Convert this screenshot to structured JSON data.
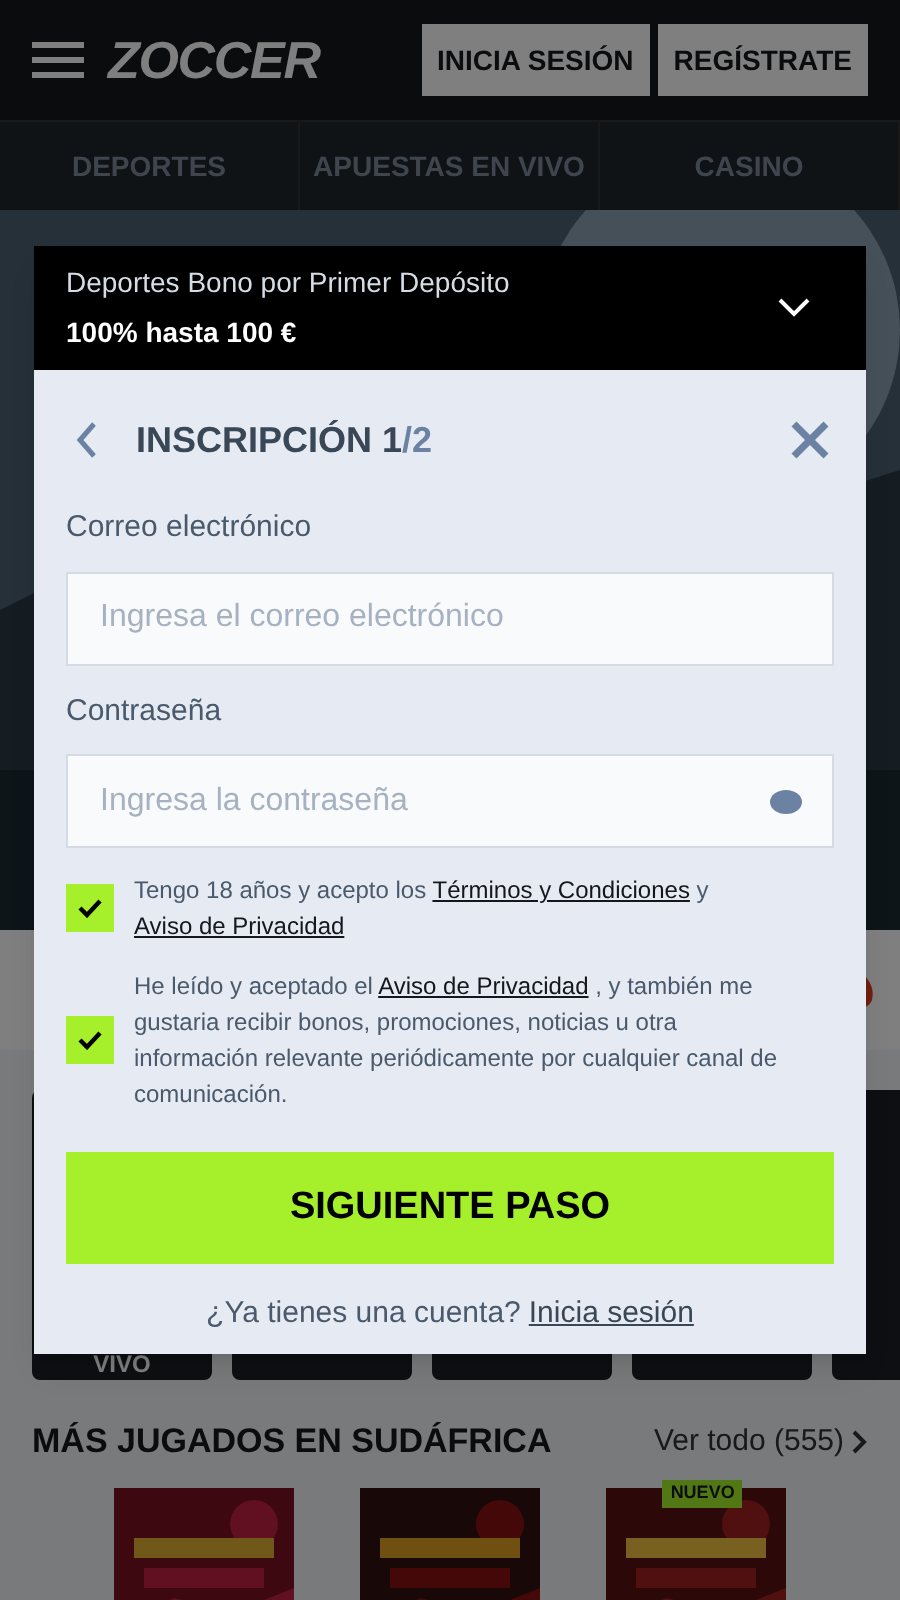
{
  "header": {
    "logo": "ZOCCER",
    "buttons": [
      "INICIA SESIÓN",
      "REGÍSTRATE"
    ]
  },
  "nav": [
    "DEPORTES",
    "APUESTAS EN VIVO",
    "CASINO"
  ],
  "tile_caption": "VIVO",
  "section": {
    "title": "MÁS JUGADOS EN SUDÁFRICA",
    "link": "Ver todo (555)"
  },
  "games": [
    {
      "kind": "picture"
    },
    {
      "kind": "picture"
    },
    {
      "kind": "picture",
      "badge": "NUEVO"
    }
  ],
  "modal": {
    "bonus": {
      "title": "Deportes Bono por Primer Depósito",
      "subtitle": "100% hasta 100 €",
      "expanded": false
    },
    "title": "INSCRIPCIÓN 1",
    "title_suffix": "/2",
    "fields": [
      {
        "kind": "email",
        "label": "Correo electrónico",
        "placeholder": "Ingresa el correo electrónico"
      },
      {
        "kind": "password",
        "label": "Contraseña",
        "placeholder": "Ingresa la contraseña"
      }
    ],
    "consents": [
      {
        "checked": true,
        "parts": [
          {
            "kind": "text",
            "text": "Tengo 18 años y acepto los "
          },
          {
            "kind": "link",
            "text": "Términos y Condiciones"
          },
          {
            "kind": "text",
            "text": " y "
          },
          {
            "kind": "link",
            "text": "Aviso de Privacidad"
          }
        ]
      },
      {
        "checked": true,
        "parts": [
          {
            "kind": "text",
            "text": "He leído y aceptado el "
          },
          {
            "kind": "link",
            "text": "Aviso de Privacidad"
          },
          {
            "kind": "text",
            "text": " , y también me gustaria recibir bonos, promociones, noticias u otra información relevante periódicamente por cualquier canal de comunicación."
          }
        ]
      }
    ],
    "submit": "SIGUIENTE PASO",
    "footer": {
      "text": "¿Ya tienes una cuenta?",
      "link": "Inicia sesión"
    }
  }
}
